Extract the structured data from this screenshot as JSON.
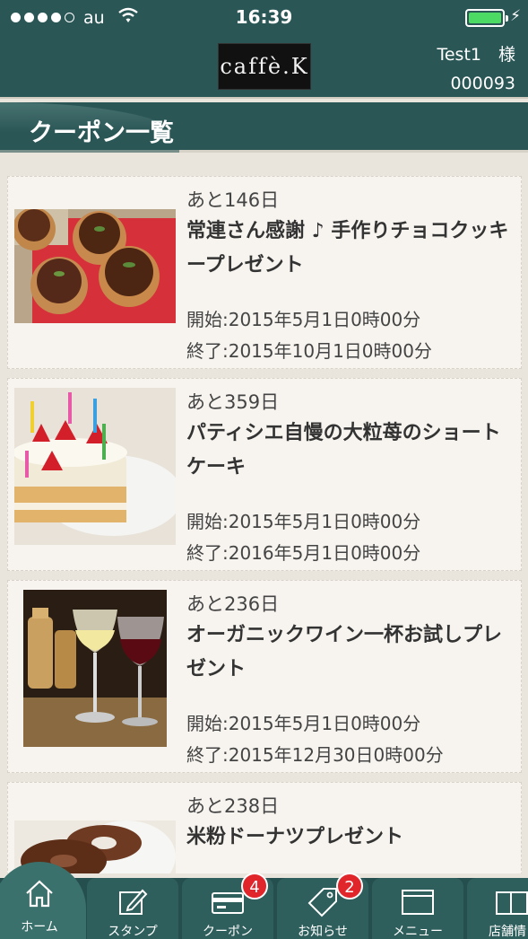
{
  "status_bar": {
    "carrier": "au",
    "time": "16:39",
    "signal_dots_filled": 4,
    "signal_dots_total": 5,
    "battery_level": 1.0
  },
  "header": {
    "logo_text": "caffè.K",
    "user_name": "Test1　様",
    "user_id": "000093"
  },
  "page_title": "クーポン一覧",
  "coupons": [
    {
      "remaining": "あと146日",
      "title": "常連さん感謝 ♪ 手作りチョコクッキープレゼント",
      "start": "開始:2015年5月1日0時00分",
      "end": "終了:2015年10月1日0時00分",
      "image": "chocolate-cookies"
    },
    {
      "remaining": "あと359日",
      "title": "パティシエ自慢の大粒苺のショートケーキ",
      "start": "開始:2015年5月1日0時00分",
      "end": "終了:2016年5月1日0時00分",
      "image": "strawberry-shortcake"
    },
    {
      "remaining": "あと236日",
      "title": "オーガニックワイン一杯お試しプレゼント",
      "start": "開始:2015年5月1日0時00分",
      "end": "終了:2015年12月30日0時00分",
      "image": "wine-glasses"
    },
    {
      "remaining": "あと238日",
      "title": "米粉ドーナツプレゼント",
      "start": "",
      "end": "",
      "image": "donuts"
    }
  ],
  "tabs": [
    {
      "label": "ホーム",
      "icon": "home-icon",
      "badge": ""
    },
    {
      "label": "スタンプ",
      "icon": "stamp-icon",
      "badge": ""
    },
    {
      "label": "クーポン",
      "icon": "coupon-card-icon",
      "badge": "4"
    },
    {
      "label": "お知らせ",
      "icon": "tag-icon",
      "badge": "2"
    },
    {
      "label": "メニュー",
      "icon": "menu-book-icon",
      "badge": ""
    },
    {
      "label": "店舗情",
      "icon": "store-book-icon",
      "badge": ""
    }
  ],
  "colors": {
    "header_bg": "#2b5656",
    "page_bg": "#e9e4dc",
    "card_bg": "#f7f4ef",
    "badge": "#e0252b",
    "battery": "#4cd964"
  }
}
